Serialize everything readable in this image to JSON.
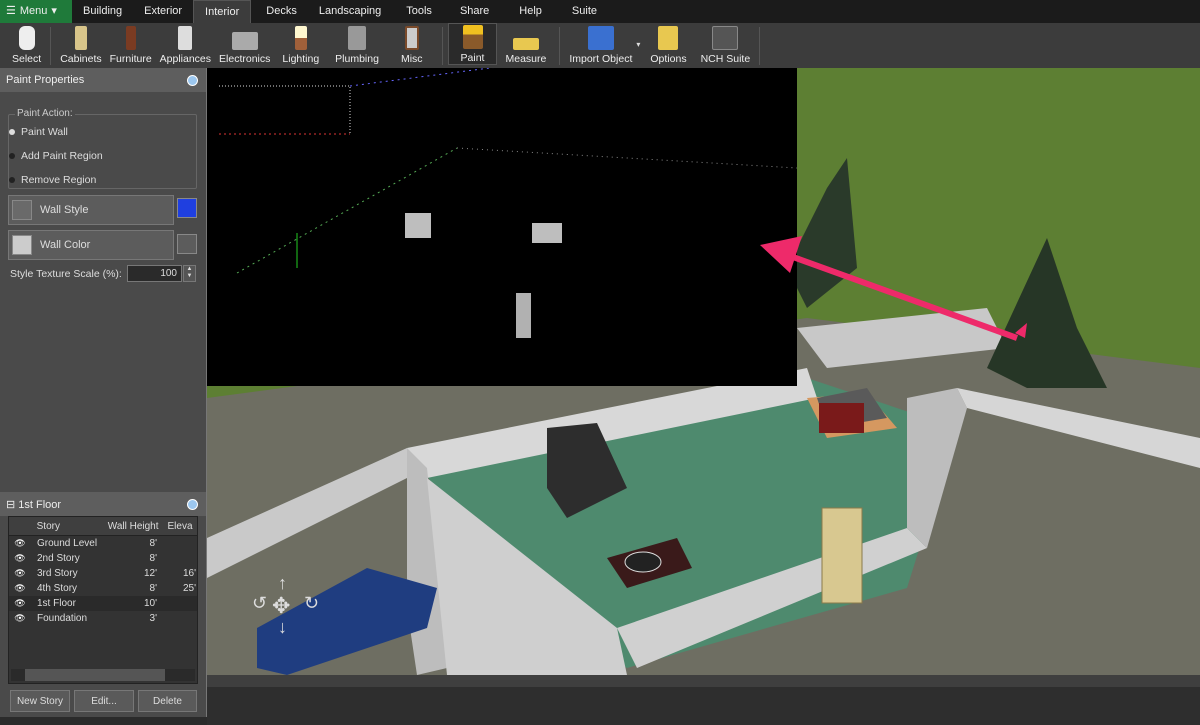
{
  "menu": {
    "label": "Menu"
  },
  "tabs": [
    "Building",
    "Exterior",
    "Interior",
    "Decks",
    "Landscaping",
    "Tools",
    "Share",
    "Help",
    "Suite"
  ],
  "active_tab": "Interior",
  "toolbar": [
    {
      "label": "Select",
      "icon": "hand-icon"
    },
    {
      "label": "Cabinets",
      "icon": "cabinet-icon"
    },
    {
      "label": "Furniture",
      "icon": "chair-icon"
    },
    {
      "label": "Appliances",
      "icon": "fridge-icon"
    },
    {
      "label": "Electronics",
      "icon": "tv-icon"
    },
    {
      "label": "Lighting",
      "icon": "lamp-icon"
    },
    {
      "label": "Plumbing",
      "icon": "faucet-icon"
    },
    {
      "label": "Misc",
      "icon": "mirror-icon"
    },
    {
      "label": "Paint",
      "icon": "paint-roller-icon"
    },
    {
      "label": "Measure",
      "icon": "ruler-icon"
    },
    {
      "label": "Import Object",
      "icon": "import-cube-icon"
    },
    {
      "label": "Options",
      "icon": "options-icon"
    },
    {
      "label": "NCH Suite",
      "icon": "nch-suite-icon"
    }
  ],
  "paint_panel": {
    "title": "Paint Properties",
    "action_label": "Paint Action:",
    "actions": [
      "Paint Wall",
      "Add Paint Region",
      "Remove Region"
    ],
    "selected_action": "Paint Wall",
    "wall_style": "Wall Style",
    "wall_color": "Wall Color",
    "scale_label": "Style Texture Scale (%):",
    "scale_value": "100"
  },
  "floor_panel": {
    "title": "1st Floor",
    "columns": [
      "Story",
      "Wall Height",
      "Eleva"
    ],
    "rows": [
      {
        "story": "Ground Level",
        "height": "8'",
        "elev": ""
      },
      {
        "story": "2nd Story",
        "height": "8'",
        "elev": ""
      },
      {
        "story": "3rd Story",
        "height": "12'",
        "elev": "16'"
      },
      {
        "story": "4th Story",
        "height": "8'",
        "elev": "25'"
      },
      {
        "story": "1st Floor",
        "height": "10'",
        "elev": ""
      },
      {
        "story": "Foundation",
        "height": "3'",
        "elev": ""
      }
    ],
    "selected": "1st Floor",
    "buttons": [
      "New Story",
      "Edit...",
      "Delete"
    ]
  },
  "colors": {
    "menu_green": "#1f7a3a",
    "arrow": "#ee2a6a",
    "grass": "#5d7f33"
  }
}
